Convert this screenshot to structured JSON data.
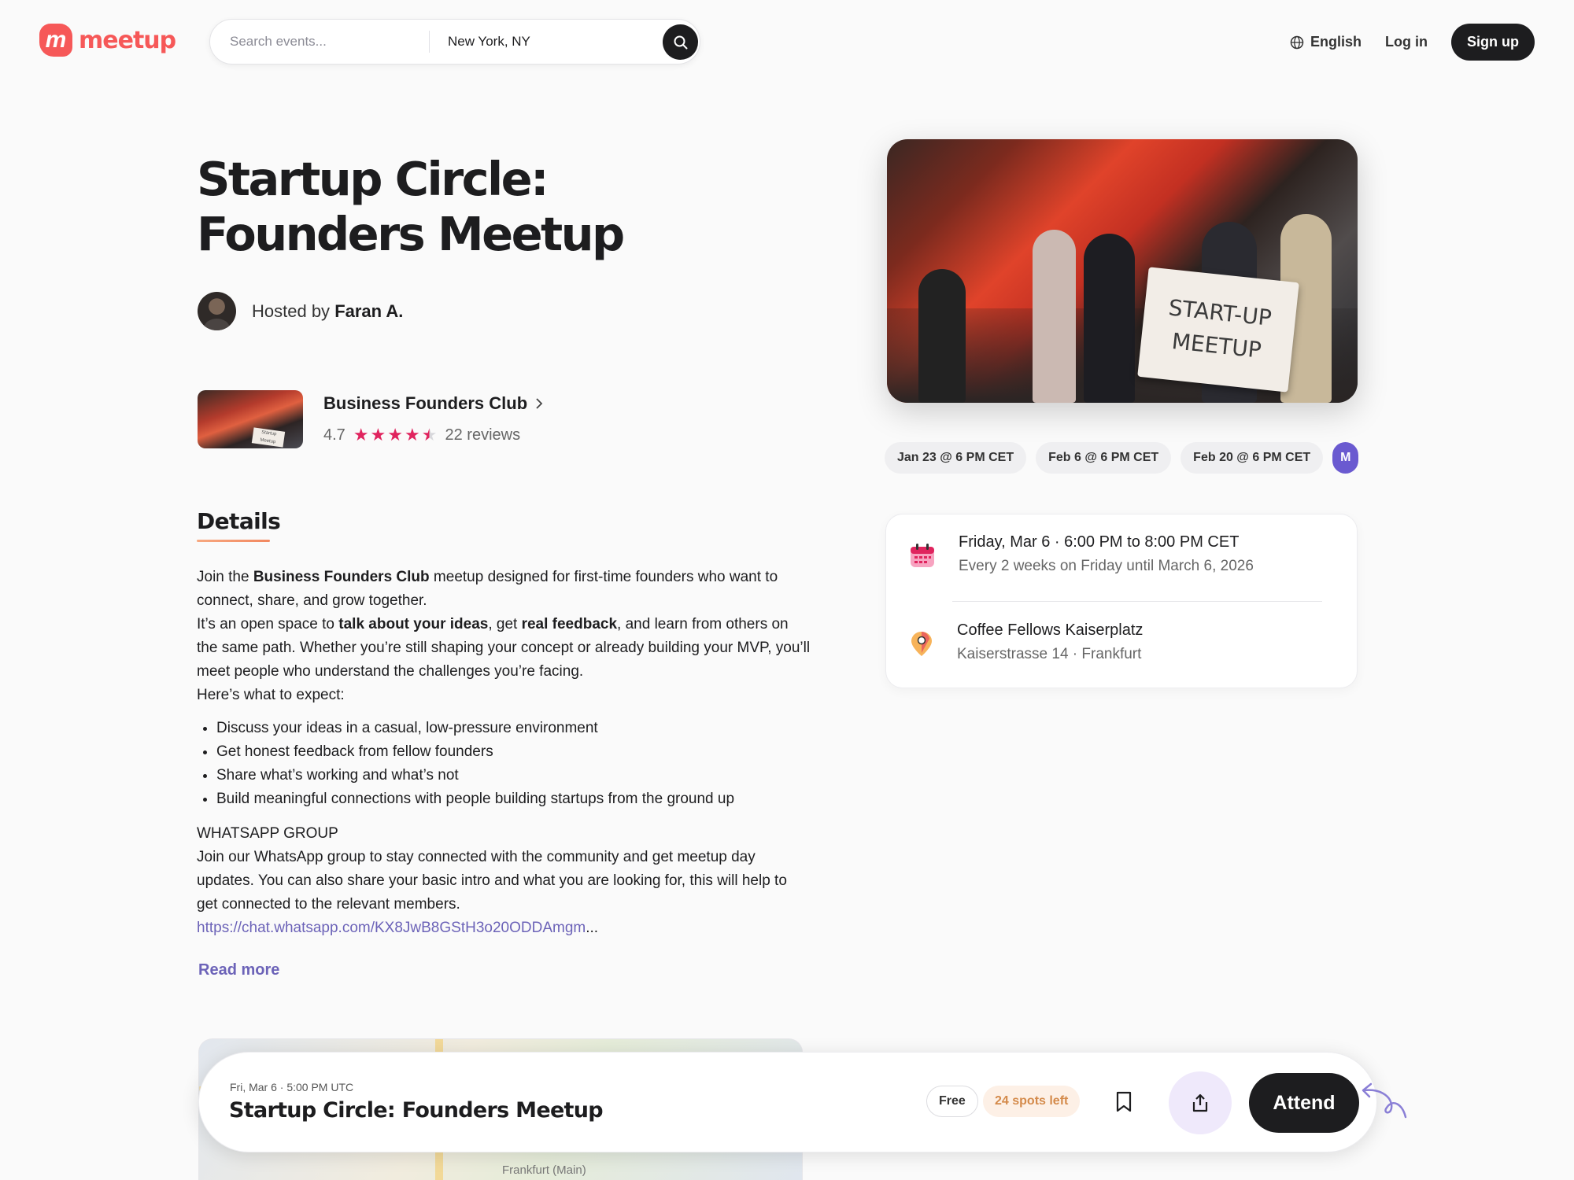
{
  "header": {
    "logo_text": "meetup",
    "logo_mark": "m",
    "search_placeholder": "Search events...",
    "location_value": "New York, NY",
    "language_label": "English",
    "login_label": "Log in",
    "signup_label": "Sign up"
  },
  "event": {
    "title": "Startup Circle: Founders Meetup",
    "hosted_by_prefix": "Hosted by",
    "host_name": "Faran A."
  },
  "group": {
    "name": "Business Founders Club",
    "rating": "4.7",
    "stars": 4.5,
    "reviews": "22 reviews",
    "thumb_sign": "Startup Meetup"
  },
  "details": {
    "heading": "Details",
    "p1_pre": "Join the ",
    "p1_bold": "Business Founders Club",
    "p1_post": " meetup designed for first-time founders who want to connect, share, and grow together.",
    "p2_a": "It’s an open space to ",
    "p2_bold1": "talk about your ideas",
    "p2_b": ", get ",
    "p2_bold2": "real feedback",
    "p2_c": ", and learn from others on the same path. Whether you’re still shaping your concept or already building your MVP, you’ll meet people who understand the challenges you’re facing.",
    "p3": "Here’s what to expect:",
    "bullets": [
      "Discuss your ideas in a casual, low-pressure environment",
      "Get honest feedback from fellow founders",
      "Share what’s working and what’s not",
      "Build meaningful connections with people building startups from the ground up"
    ],
    "wa_heading": "WHATSAPP GROUP",
    "wa_text": "Join our WhatsApp group to stay connected with the community and get meetup day updates. You can also share your basic intro and what you are looking for, this will help to get connected to the relevant members.",
    "wa_link": "https://chat.whatsapp.com/KX8JwB8GStH3o20ODDAmgm",
    "wa_ellipsis": "...",
    "read_more": "Read more"
  },
  "map": {
    "label": "Frankfurt (Main)"
  },
  "hero": {
    "sign_line1": "START-UP",
    "sign_line2": "MEETUP"
  },
  "dates": [
    "Jan 23 @ 6 PM CET",
    "Feb 6 @ 6 PM CET",
    "Feb 20 @ 6 PM CET",
    "M"
  ],
  "info": {
    "datetime": "Friday, Mar 6 · 6:00 PM to 8:00 PM CET",
    "recurrence": "Every 2 weeks on Friday until March 6, 2026",
    "venue": "Coffee Fellows Kaiserplatz",
    "address": "Kaiserstrasse 14 · Frankfurt"
  },
  "sticky": {
    "date": "Fri, Mar 6 · 5:00 PM UTC",
    "title": "Startup Circle: Founders Meetup",
    "price": "Free",
    "spots": "24 spots left",
    "attend_label": "Attend"
  },
  "colors": {
    "brand": "#f65858",
    "dark": "#1d1d1f",
    "link": "#6c63b8",
    "star": "#e0245e",
    "spots": "#d48a4a"
  },
  "icons": [
    "search-icon",
    "globe-icon",
    "chevron-right-icon",
    "star-icon",
    "calendar-icon",
    "map-pin-icon",
    "bookmark-icon",
    "share-icon",
    "arrow-doodle-icon"
  ]
}
